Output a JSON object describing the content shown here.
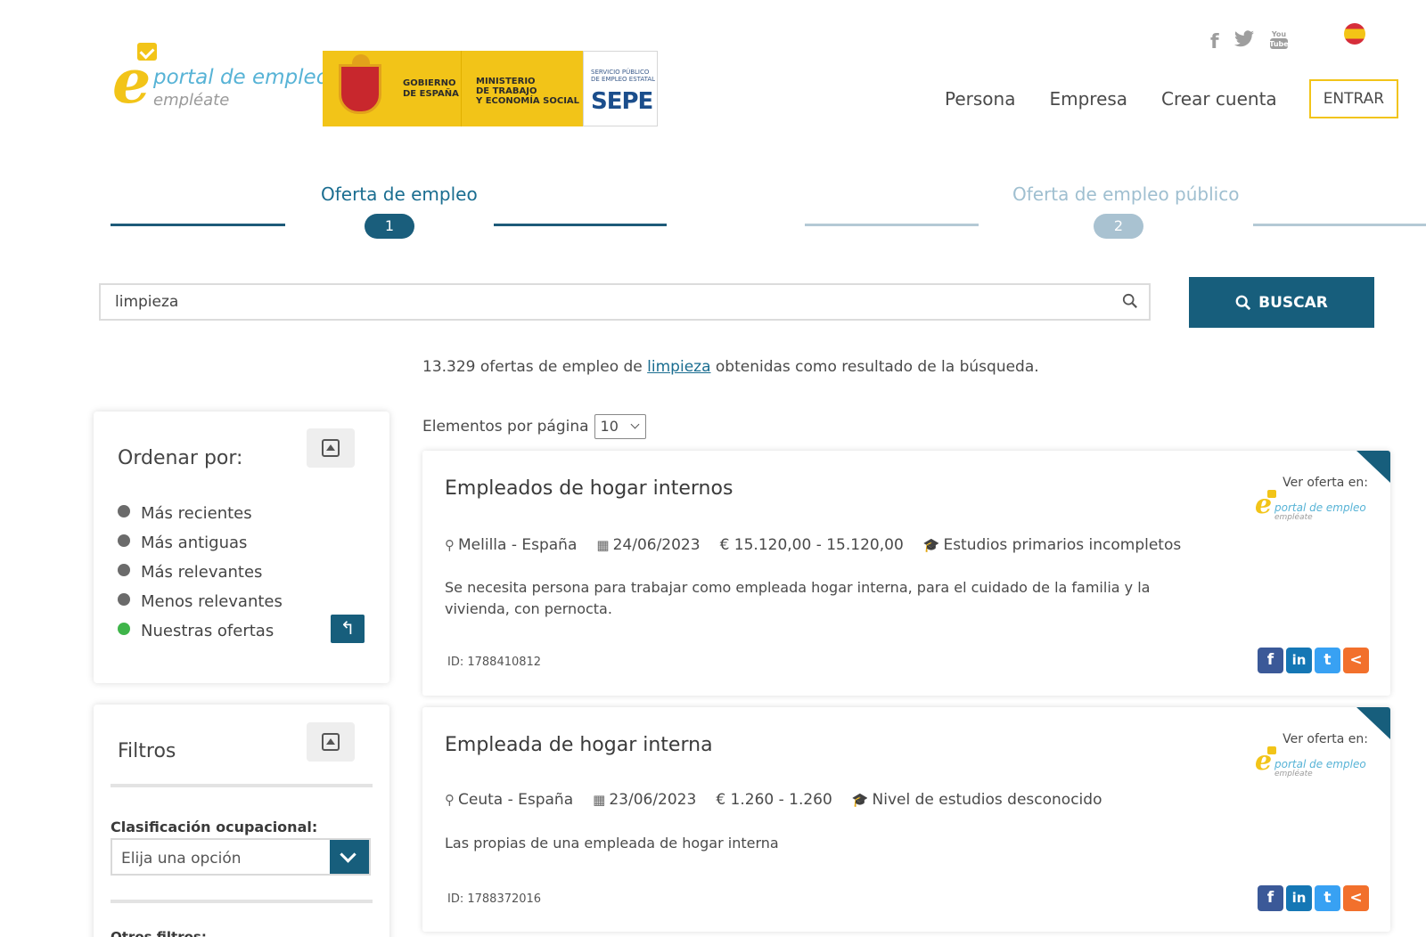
{
  "header": {
    "logo_line1": "portal de empleo",
    "logo_line2": "empléate",
    "gov_line1": "GOBIERNO",
    "gov_line2": "DE ESPAÑA",
    "min_line1": "MINISTERIO",
    "min_line2": "DE TRABAJO",
    "min_line3": "Y ECONOMÍA SOCIAL",
    "sepe_small1": "SERVICIO PÚBLICO",
    "sepe_small2": "DE EMPLEO ESTATAL",
    "sepe_big": "SEPE",
    "nav": [
      "Persona",
      "Empresa",
      "Crear cuenta"
    ],
    "login_label": "ENTRAR"
  },
  "steps": [
    {
      "title": "Oferta de empleo",
      "number": "1",
      "active": true
    },
    {
      "title": "Oferta de empleo público",
      "number": "2",
      "active": false
    }
  ],
  "search": {
    "value": "limpieza",
    "button_label": "BUSCAR"
  },
  "results": {
    "count": "13.329",
    "prefix": " ofertas de empleo de ",
    "term": "limpieza",
    "suffix": " obtenidas como resultado de la búsqueda."
  },
  "per_page": {
    "label": "Elementos por página",
    "value": "10"
  },
  "sort_panel": {
    "title": "Ordenar por:",
    "options": [
      {
        "label": "Más recientes",
        "selected": false
      },
      {
        "label": "Más antiguas",
        "selected": false
      },
      {
        "label": "Más relevantes",
        "selected": false
      },
      {
        "label": "Menos relevantes",
        "selected": false
      },
      {
        "label": "Nuestras ofertas",
        "selected": true
      }
    ]
  },
  "filter_panel": {
    "title": "Filtros",
    "occupation_label": "Clasificación ocupacional:",
    "occupation_placeholder": "Elija una opción",
    "other_label": "Otros filtros:"
  },
  "offers": [
    {
      "title": "Empleados de hogar internos",
      "location": "Melilla - España",
      "date": "24/06/2023",
      "salary": "€ 15.120,00 - 15.120,00",
      "education": "Estudios primarios incompletos",
      "description": "Se necesita persona para trabajar como empleada hogar interna, para el cuidado de la familia y la vivienda, con pernocta.",
      "id": "ID: 1788410812",
      "source_label": "Ver oferta en:"
    },
    {
      "title": "Empleada de hogar interna",
      "location": "Ceuta - España",
      "date": "23/06/2023",
      "salary": "€ 1.260 - 1.260",
      "education": "Nivel de estudios desconocido",
      "description": "Las propias de una empleada de hogar interna",
      "id": "ID: 1788372016",
      "source_label": "Ver oferta en:"
    }
  ],
  "mini_logo": {
    "line1": "portal de empleo",
    "line2": "empléate"
  },
  "colors": {
    "primary": "#175e7c",
    "accent": "#f2c418",
    "link": "#1a6d90"
  }
}
